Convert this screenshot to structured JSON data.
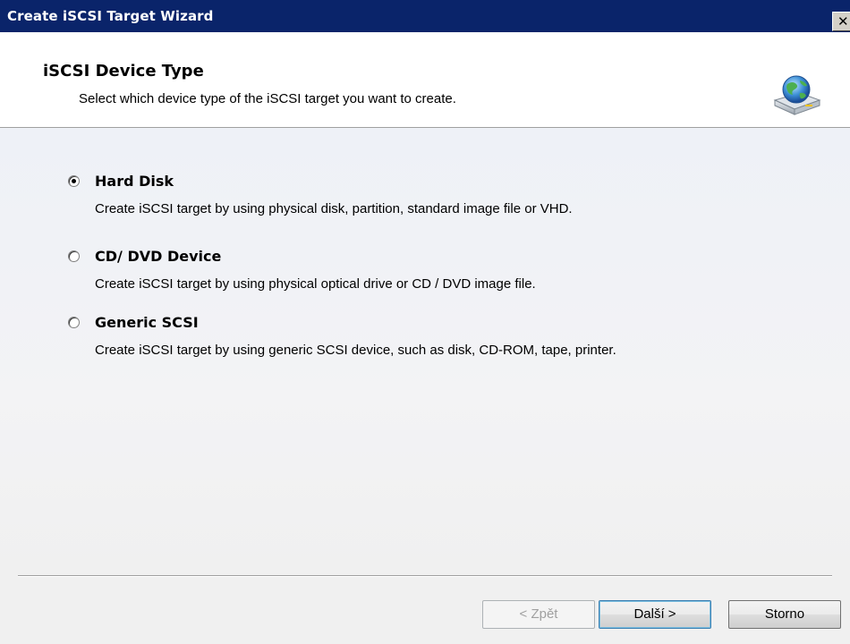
{
  "window": {
    "title": "Create iSCSI Target Wizard",
    "close_label": "✕"
  },
  "header": {
    "title": "iSCSI Device Type",
    "subtitle": "Select which device type of the iSCSI target you want to create.",
    "icon": "globe-disk-icon"
  },
  "options": [
    {
      "label": "Hard Disk",
      "description": "Create iSCSI target by using physical disk, partition, standard image file or VHD.",
      "selected": true
    },
    {
      "label": "CD/ DVD Device",
      "description": "Create iSCSI target by using physical optical drive or CD / DVD image file.",
      "selected": false
    },
    {
      "label": "Generic SCSI",
      "description": "Create iSCSI target by using generic SCSI device, such as disk, CD-ROM, tape, printer.",
      "selected": false
    }
  ],
  "footer": {
    "back_label": "< Zpět",
    "next_label": "Další >",
    "cancel_label": "Storno"
  },
  "colors": {
    "titlebar": "#0a246a",
    "header_bg": "#ffffff",
    "content_bg": "#f0f0f0"
  }
}
